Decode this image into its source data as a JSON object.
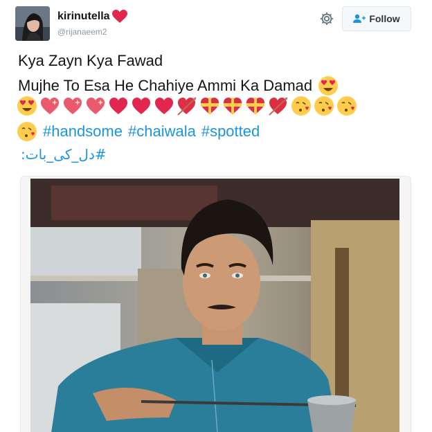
{
  "user": {
    "display_name": "kirinutella",
    "handle": "@rijanaeem2"
  },
  "actions": {
    "follow_label": "Follow",
    "settings_icon": "gear-icon",
    "follow_icon": "add-user-icon"
  },
  "tweet": {
    "line1": "Kya Zayn Kya Fawad",
    "line2": "Mujhe To Esa He Chahiye Ammi Ka Damad",
    "hashtags": [
      "#handsome",
      "#chaiwala",
      "#spotted"
    ],
    "urdu_tag": "#دل_کی_بات:",
    "emoji_row": [
      "heart-eyes",
      "sparkling-heart",
      "sparkling-heart",
      "sparkling-heart",
      "heart",
      "heart",
      "heart",
      "heart-with-arrow",
      "heart-with-ribbon",
      "heart-with-ribbon",
      "heart-with-ribbon",
      "heart-with-arrow",
      "face-blowing-kiss",
      "face-blowing-kiss",
      "face-blowing-kiss"
    ]
  },
  "colors": {
    "link": "#1b95e0",
    "text": "#14171a",
    "muted": "#8899a6",
    "heart": "#e2264d",
    "emoji_yellow": "#ffcc4d"
  }
}
